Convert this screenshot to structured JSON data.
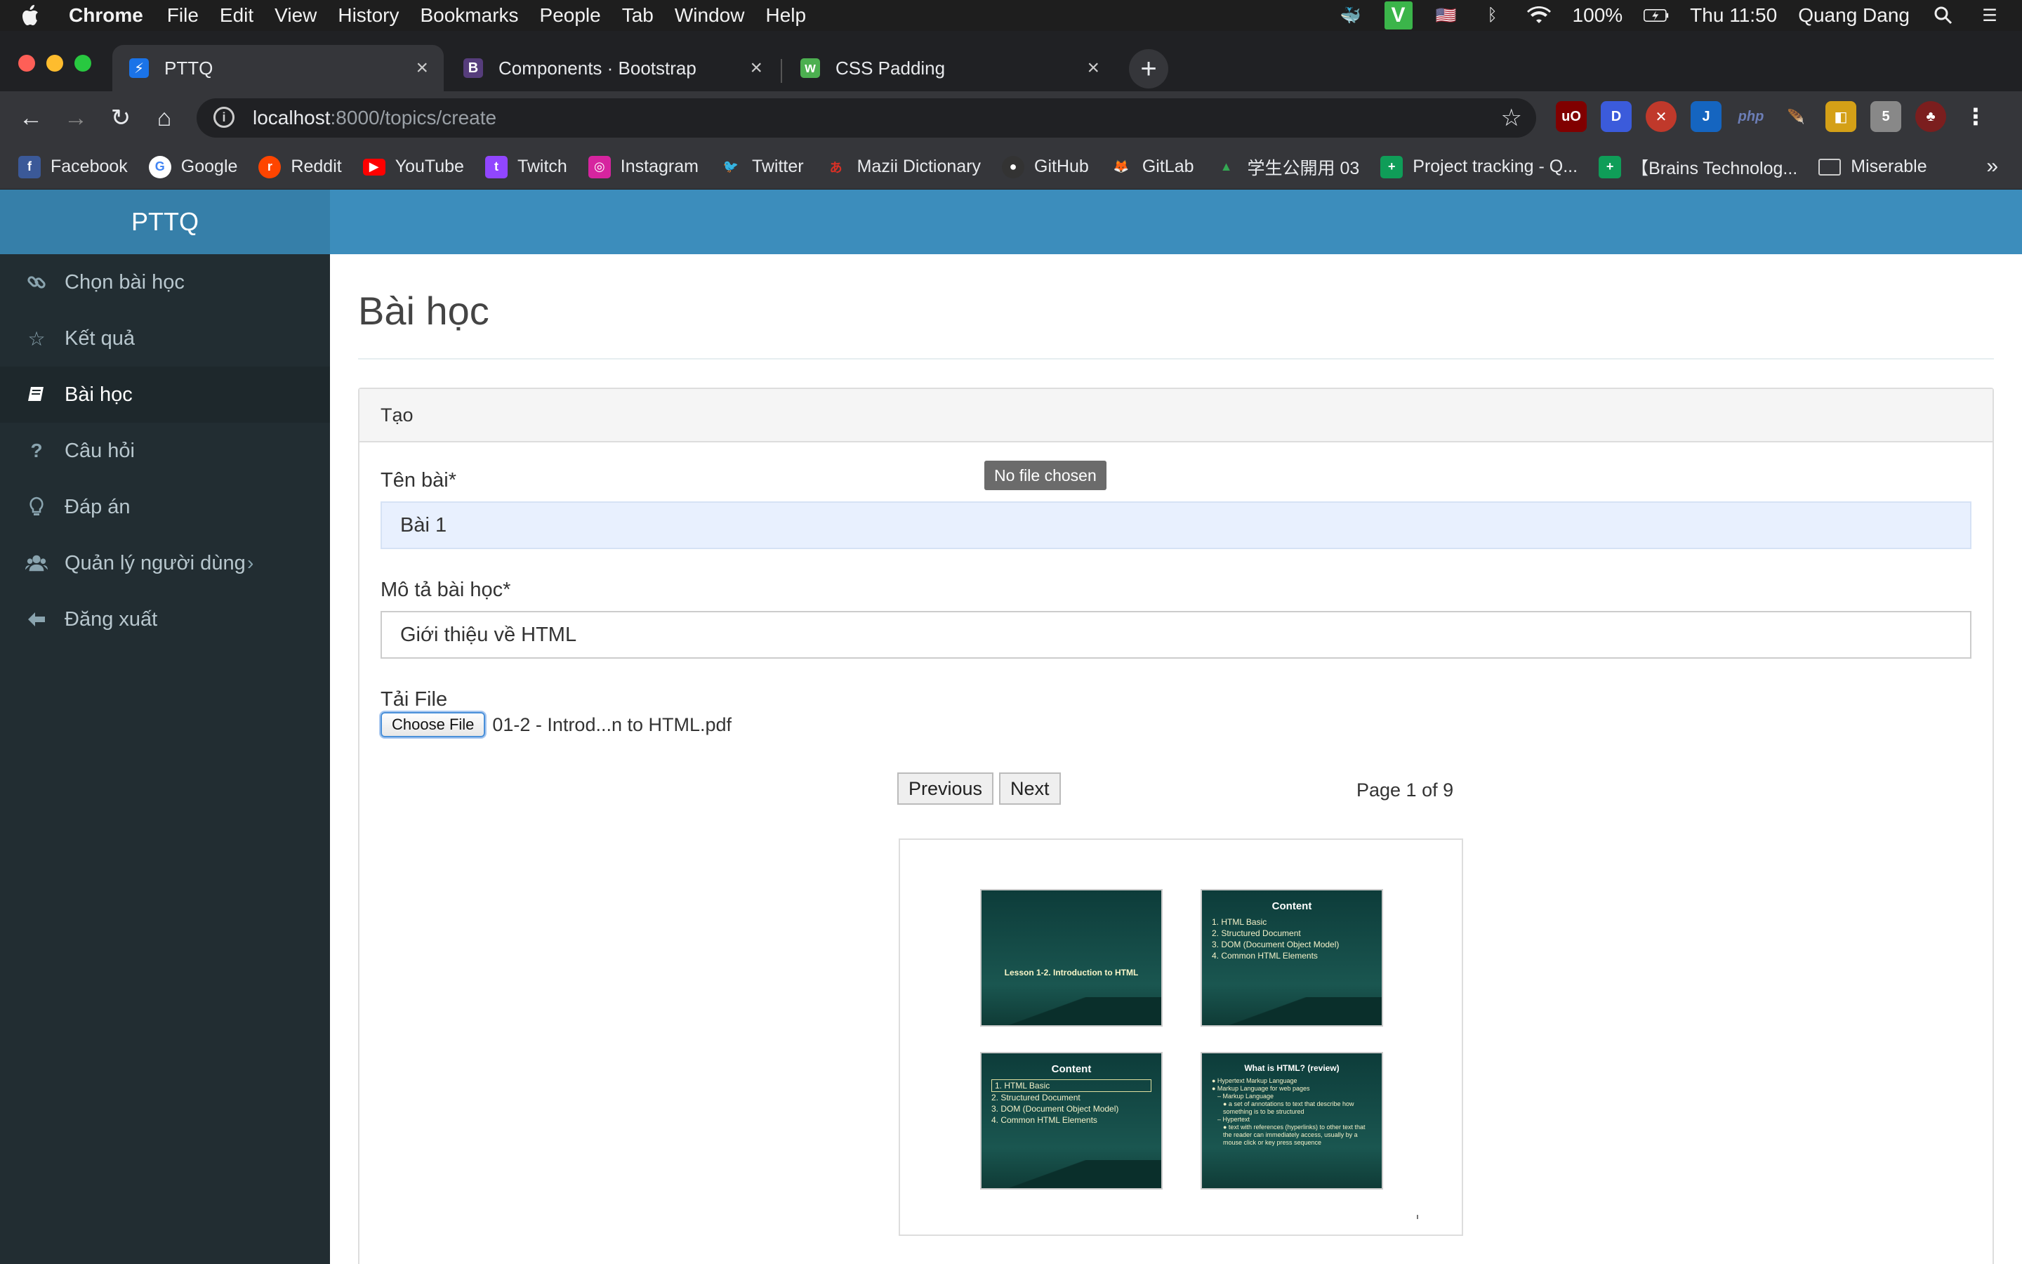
{
  "menubar": {
    "app": "Chrome",
    "items": [
      "File",
      "Edit",
      "View",
      "History",
      "Bookmarks",
      "People",
      "Tab",
      "Window",
      "Help"
    ],
    "battery": "100%",
    "clock": "Thu 11:50",
    "user": "Quang Dang"
  },
  "tabs": [
    {
      "title": "PTTQ",
      "icon": "pttq-favicon"
    },
    {
      "title": "Components · Bootstrap",
      "icon": "bootstrap-favicon"
    },
    {
      "title": "CSS Padding",
      "icon": "w3schools-favicon"
    }
  ],
  "omnibox": {
    "host": "localhost",
    "path": ":8000/topics/create"
  },
  "bookmarks": [
    {
      "label": "Facebook",
      "color": "#3b5998",
      "glyph": "f"
    },
    {
      "label": "Google",
      "color": "#ffffff",
      "glyph": "G"
    },
    {
      "label": "Reddit",
      "color": "#ff4500",
      "glyph": "r"
    },
    {
      "label": "YouTube",
      "color": "#ff0000",
      "glyph": "▶"
    },
    {
      "label": "Twitch",
      "color": "#9146ff",
      "glyph": "t"
    },
    {
      "label": "Instagram",
      "color": "#d6249f",
      "glyph": "◎"
    },
    {
      "label": "Twitter",
      "color": "#1da1f2",
      "glyph": "t"
    },
    {
      "label": "Mazii Dictionary",
      "color": "#d93025",
      "glyph": "あ"
    },
    {
      "label": "GitHub",
      "color": "#333333",
      "glyph": "●"
    },
    {
      "label": "GitLab",
      "color": "#fc6d26",
      "glyph": "◆"
    },
    {
      "label": "学生公開用 03",
      "color": "#34a853",
      "glyph": "▲"
    },
    {
      "label": "Project tracking - Q...",
      "color": "#0f9d58",
      "glyph": "+"
    },
    {
      "label": "【Brains Technolog...",
      "color": "#0f9d58",
      "glyph": "+"
    },
    {
      "label": "Miserable",
      "color": "#9aa0a6",
      "glyph": "▭"
    }
  ],
  "sidebar": {
    "brand": "PTTQ",
    "items": [
      {
        "label": "Chọn bài học",
        "icon": "link-icon",
        "glyph": "🔗"
      },
      {
        "label": "Kết quả",
        "icon": "star-icon",
        "glyph": "☆"
      },
      {
        "label": "Bài học",
        "icon": "book-icon",
        "glyph": "📘"
      },
      {
        "label": "Câu hỏi",
        "icon": "question-icon",
        "glyph": "?"
      },
      {
        "label": "Đáp án",
        "icon": "lightbulb-icon",
        "glyph": "💡"
      },
      {
        "label": "Quản lý người dùng",
        "icon": "users-icon",
        "glyph": "👥"
      },
      {
        "label": "Đăng xuất",
        "icon": "arrow-left-icon",
        "glyph": "⬅"
      }
    ]
  },
  "page": {
    "title": "Bài học",
    "panel_heading": "Tạo",
    "name_label": "Tên bài*",
    "name_value": "Bài 1",
    "desc_label": "Mô tả bài học*",
    "desc_value": "Giới thiệu về HTML",
    "file_label": "Tải File",
    "choose_file": "Choose File",
    "file_name": "01-2 - Introd...n to HTML.pdf",
    "tooltip": "No file chosen",
    "prev": "Previous",
    "next": "Next",
    "page_info": "Page 1 of 9"
  },
  "slides": [
    {
      "title": "",
      "center": "Lesson 1-2. Introduction to HTML",
      "body": []
    },
    {
      "title": "Content",
      "center": "",
      "body": [
        "1. HTML Basic",
        "2. Structured Document",
        "3. DOM (Document Object Model)",
        "4. Common HTML Elements"
      ]
    },
    {
      "title": "Content",
      "center": "",
      "body": [
        "1. HTML Basic",
        "2. Structured Document",
        "3. DOM (Document Object Model)",
        "4. Common HTML Elements"
      ]
    },
    {
      "title": "What is HTML? (review)",
      "center": "",
      "body": [
        "● Hypertext Markup Language",
        "● Markup Language for web pages",
        "– Markup Language",
        "● a set of annotations to text that describe how something is to be structured",
        "– Hypertext",
        "● text with references (hyperlinks) to other text that the reader can immediately access, usually by a mouse click or key press sequence"
      ]
    }
  ]
}
